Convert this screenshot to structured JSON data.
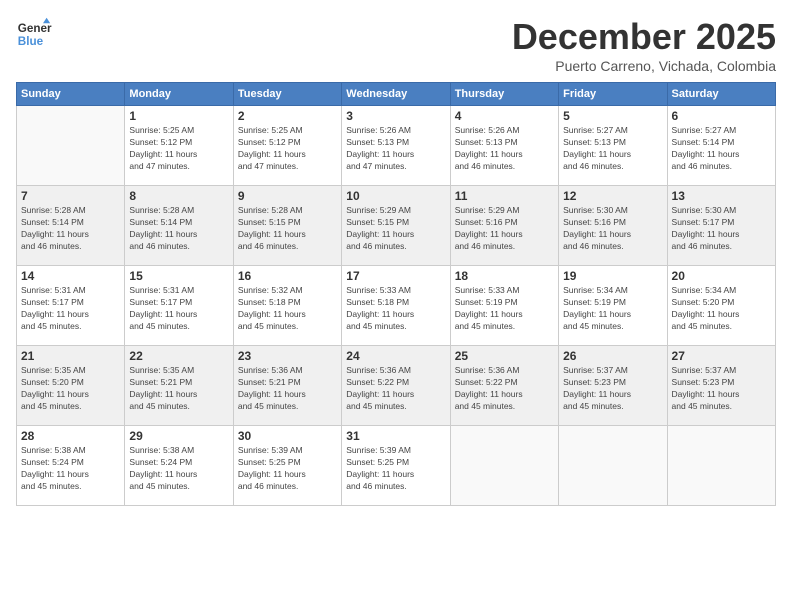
{
  "logo": {
    "line1": "General",
    "line2": "Blue"
  },
  "title": "December 2025",
  "location": "Puerto Carreno, Vichada, Colombia",
  "header": {
    "days": [
      "Sunday",
      "Monday",
      "Tuesday",
      "Wednesday",
      "Thursday",
      "Friday",
      "Saturday"
    ]
  },
  "weeks": [
    [
      {
        "day": "",
        "info": ""
      },
      {
        "day": "1",
        "info": "Sunrise: 5:25 AM\nSunset: 5:12 PM\nDaylight: 11 hours\nand 47 minutes."
      },
      {
        "day": "2",
        "info": "Sunrise: 5:25 AM\nSunset: 5:12 PM\nDaylight: 11 hours\nand 47 minutes."
      },
      {
        "day": "3",
        "info": "Sunrise: 5:26 AM\nSunset: 5:13 PM\nDaylight: 11 hours\nand 47 minutes."
      },
      {
        "day": "4",
        "info": "Sunrise: 5:26 AM\nSunset: 5:13 PM\nDaylight: 11 hours\nand 46 minutes."
      },
      {
        "day": "5",
        "info": "Sunrise: 5:27 AM\nSunset: 5:13 PM\nDaylight: 11 hours\nand 46 minutes."
      },
      {
        "day": "6",
        "info": "Sunrise: 5:27 AM\nSunset: 5:14 PM\nDaylight: 11 hours\nand 46 minutes."
      }
    ],
    [
      {
        "day": "7",
        "info": "Sunrise: 5:28 AM\nSunset: 5:14 PM\nDaylight: 11 hours\nand 46 minutes."
      },
      {
        "day": "8",
        "info": "Sunrise: 5:28 AM\nSunset: 5:14 PM\nDaylight: 11 hours\nand 46 minutes."
      },
      {
        "day": "9",
        "info": "Sunrise: 5:28 AM\nSunset: 5:15 PM\nDaylight: 11 hours\nand 46 minutes."
      },
      {
        "day": "10",
        "info": "Sunrise: 5:29 AM\nSunset: 5:15 PM\nDaylight: 11 hours\nand 46 minutes."
      },
      {
        "day": "11",
        "info": "Sunrise: 5:29 AM\nSunset: 5:16 PM\nDaylight: 11 hours\nand 46 minutes."
      },
      {
        "day": "12",
        "info": "Sunrise: 5:30 AM\nSunset: 5:16 PM\nDaylight: 11 hours\nand 46 minutes."
      },
      {
        "day": "13",
        "info": "Sunrise: 5:30 AM\nSunset: 5:17 PM\nDaylight: 11 hours\nand 46 minutes."
      }
    ],
    [
      {
        "day": "14",
        "info": "Sunrise: 5:31 AM\nSunset: 5:17 PM\nDaylight: 11 hours\nand 45 minutes."
      },
      {
        "day": "15",
        "info": "Sunrise: 5:31 AM\nSunset: 5:17 PM\nDaylight: 11 hours\nand 45 minutes."
      },
      {
        "day": "16",
        "info": "Sunrise: 5:32 AM\nSunset: 5:18 PM\nDaylight: 11 hours\nand 45 minutes."
      },
      {
        "day": "17",
        "info": "Sunrise: 5:33 AM\nSunset: 5:18 PM\nDaylight: 11 hours\nand 45 minutes."
      },
      {
        "day": "18",
        "info": "Sunrise: 5:33 AM\nSunset: 5:19 PM\nDaylight: 11 hours\nand 45 minutes."
      },
      {
        "day": "19",
        "info": "Sunrise: 5:34 AM\nSunset: 5:19 PM\nDaylight: 11 hours\nand 45 minutes."
      },
      {
        "day": "20",
        "info": "Sunrise: 5:34 AM\nSunset: 5:20 PM\nDaylight: 11 hours\nand 45 minutes."
      }
    ],
    [
      {
        "day": "21",
        "info": "Sunrise: 5:35 AM\nSunset: 5:20 PM\nDaylight: 11 hours\nand 45 minutes."
      },
      {
        "day": "22",
        "info": "Sunrise: 5:35 AM\nSunset: 5:21 PM\nDaylight: 11 hours\nand 45 minutes."
      },
      {
        "day": "23",
        "info": "Sunrise: 5:36 AM\nSunset: 5:21 PM\nDaylight: 11 hours\nand 45 minutes."
      },
      {
        "day": "24",
        "info": "Sunrise: 5:36 AM\nSunset: 5:22 PM\nDaylight: 11 hours\nand 45 minutes."
      },
      {
        "day": "25",
        "info": "Sunrise: 5:36 AM\nSunset: 5:22 PM\nDaylight: 11 hours\nand 45 minutes."
      },
      {
        "day": "26",
        "info": "Sunrise: 5:37 AM\nSunset: 5:23 PM\nDaylight: 11 hours\nand 45 minutes."
      },
      {
        "day": "27",
        "info": "Sunrise: 5:37 AM\nSunset: 5:23 PM\nDaylight: 11 hours\nand 45 minutes."
      }
    ],
    [
      {
        "day": "28",
        "info": "Sunrise: 5:38 AM\nSunset: 5:24 PM\nDaylight: 11 hours\nand 45 minutes."
      },
      {
        "day": "29",
        "info": "Sunrise: 5:38 AM\nSunset: 5:24 PM\nDaylight: 11 hours\nand 45 minutes."
      },
      {
        "day": "30",
        "info": "Sunrise: 5:39 AM\nSunset: 5:25 PM\nDaylight: 11 hours\nand 46 minutes."
      },
      {
        "day": "31",
        "info": "Sunrise: 5:39 AM\nSunset: 5:25 PM\nDaylight: 11 hours\nand 46 minutes."
      },
      {
        "day": "",
        "info": ""
      },
      {
        "day": "",
        "info": ""
      },
      {
        "day": "",
        "info": ""
      }
    ]
  ]
}
